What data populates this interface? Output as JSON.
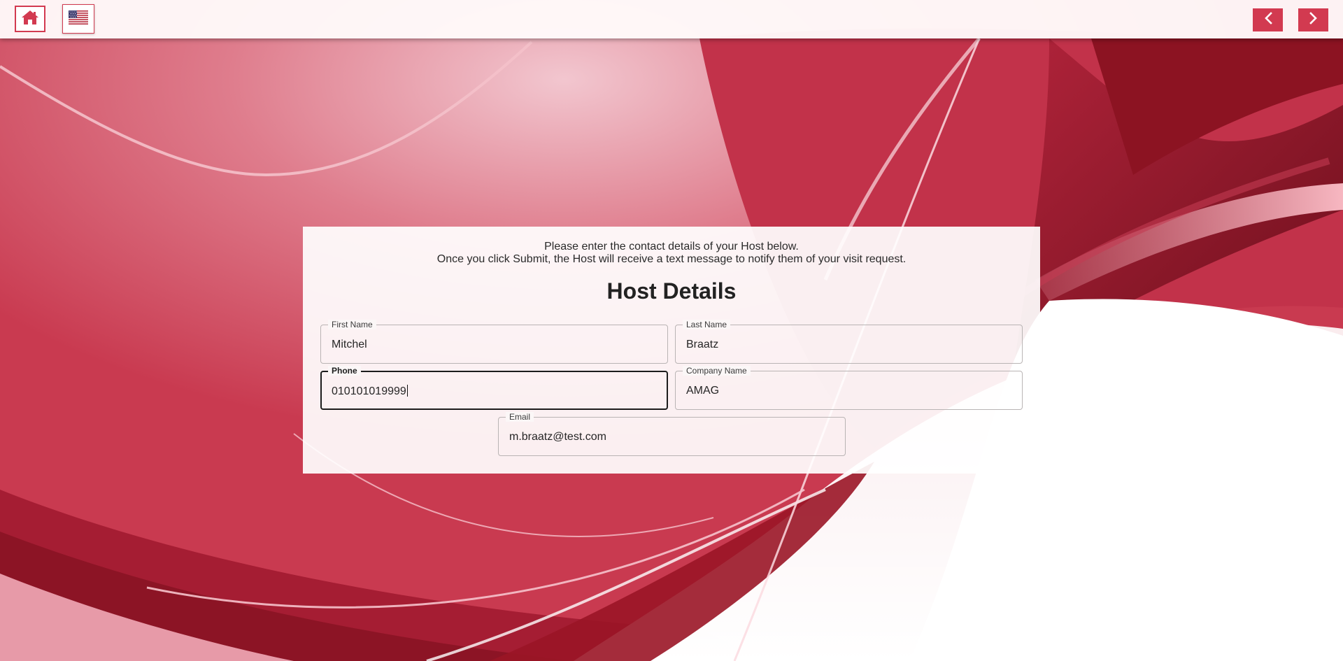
{
  "topbar": {
    "home_icon": "home-icon",
    "language_icon": "us-flag-icon",
    "back_icon": "chevron-left-icon",
    "next_icon": "chevron-right-icon",
    "accent_color": "#d23a50"
  },
  "form": {
    "intro_line1": "Please enter the contact details of your Host below.",
    "intro_line2": "Once you click Submit, the Host will receive a text message to notify them of your visit request.",
    "title": "Host Details",
    "fields": {
      "first_name": {
        "label": "First Name",
        "value": "Mitchel"
      },
      "last_name": {
        "label": "Last Name",
        "value": "Braatz"
      },
      "phone": {
        "label": "Phone",
        "value": "010101019999",
        "focused": true
      },
      "company_name": {
        "label": "Company Name",
        "value": "AMAG"
      },
      "email": {
        "label": "Email",
        "value": "m.braatz@test.com"
      }
    }
  }
}
